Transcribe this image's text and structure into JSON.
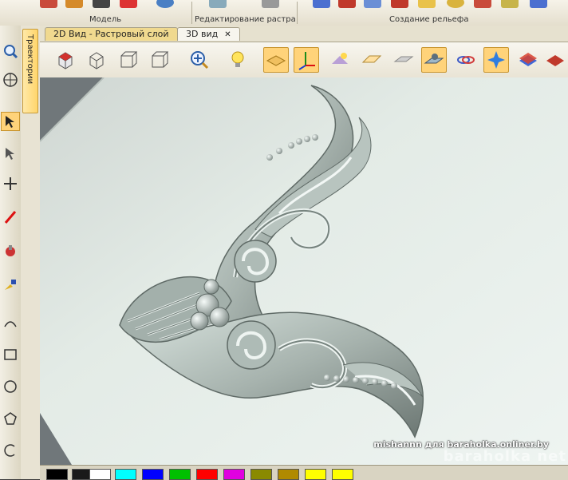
{
  "ribbon": {
    "groups": [
      {
        "label": "Модель"
      },
      {
        "label": "Редактирование растра"
      },
      {
        "label": "Создание рельефа"
      }
    ]
  },
  "side_panel": {
    "tab_label": "Траектории"
  },
  "tabs": [
    {
      "label": "2D Вид - Растровый слой",
      "active": false
    },
    {
      "label": "3D вид",
      "active": true,
      "close": "✕"
    }
  ],
  "toolbar_icons": [
    "iso-view-icon",
    "front-view-icon",
    "side-view-icon",
    "top-view-icon",
    "zoom-fit-icon",
    "light-bulb-icon",
    "plane-display-icon",
    "axes-icon",
    "relief-shade-icon",
    "relief-raise-icon",
    "relief-smooth-icon",
    "relief-select-icon",
    "relief-weave-icon",
    "relief-star-icon",
    "layer-blue-icon",
    "layer-red-icon"
  ],
  "palette_colors": [
    "#000000",
    "#1a1a1a",
    "#ffffff",
    "#00ffff",
    "#0000ff",
    "#00c000",
    "#ff0000",
    "#e000e0",
    "#8a8a00",
    "#b08a00",
    "#ffff00"
  ],
  "watermark": "mishannn для baraholka.onliner.by",
  "brand": "baraholka net"
}
